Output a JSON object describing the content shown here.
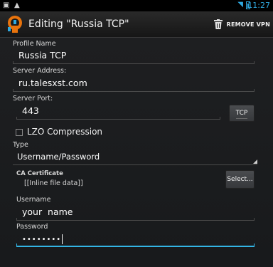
{
  "status": {
    "time": "11:27",
    "wifi_icon": "wifi-icon",
    "battery_icon": "battery-icon"
  },
  "actionbar": {
    "title": "Editing \"Russia TCP\"",
    "remove_label": "REMOVE VPN"
  },
  "form": {
    "profile_name_label": "Profile Name",
    "profile_name_value": "Russia TCP",
    "server_address_label": "Server Address:",
    "server_address_value": "ru.talesxst.com",
    "server_port_label": "Server Port:",
    "server_port_value": "443",
    "protocol_button": "TCP",
    "lzo_label": "LZO Compression",
    "lzo_checked": false,
    "type_label": "Type",
    "type_value": "Username/Password",
    "ca_label": "CA Certificate",
    "ca_value": "[[Inline file data]]",
    "select_button": "Select...",
    "username_label": "Username",
    "username_value": "your  name",
    "password_label": "Password",
    "password_value": "••••••••"
  },
  "colors": {
    "accent": "#33b5e5",
    "background": "#1c1d1f"
  }
}
